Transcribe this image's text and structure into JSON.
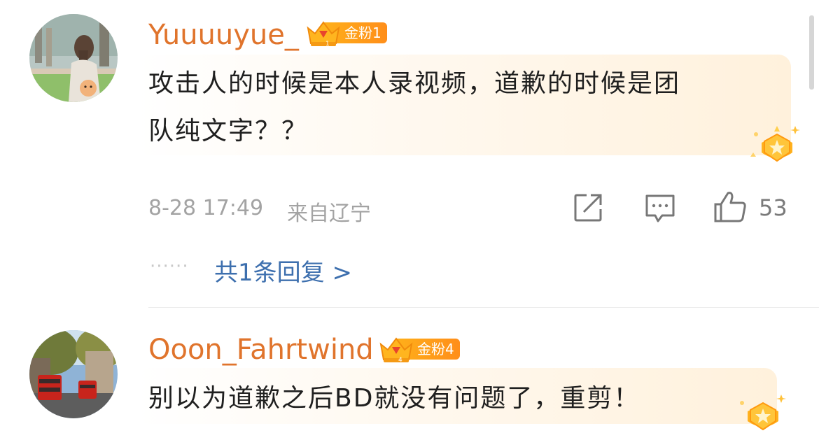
{
  "comments": [
    {
      "username": "Yuuuuyue_",
      "fan_badge": "金粉1",
      "text_lines": [
        "攻击人的时候是本人录视频，道歉的时候是团",
        "队纯文字？？"
      ],
      "time": "8-28 17:49",
      "location": "来自辽宁",
      "like_count": "53",
      "replies_link": "共1条回复 >",
      "dots": "······"
    },
    {
      "username": "Ooon_Fahrtwind",
      "fan_badge": "金粉4",
      "text_lines": [
        "别以为道歉之后BD就没有问题了，重剪！"
      ]
    }
  ],
  "icons": {
    "share": "share-icon",
    "comment": "comment-icon",
    "like": "thumbs-up-icon",
    "medal": "star-medal-icon",
    "crown": "crown-icon"
  },
  "colors": {
    "username": "#e0742c",
    "badge": "#ff9c1a",
    "link": "#3d6fae",
    "meta": "#a3a3a3"
  }
}
